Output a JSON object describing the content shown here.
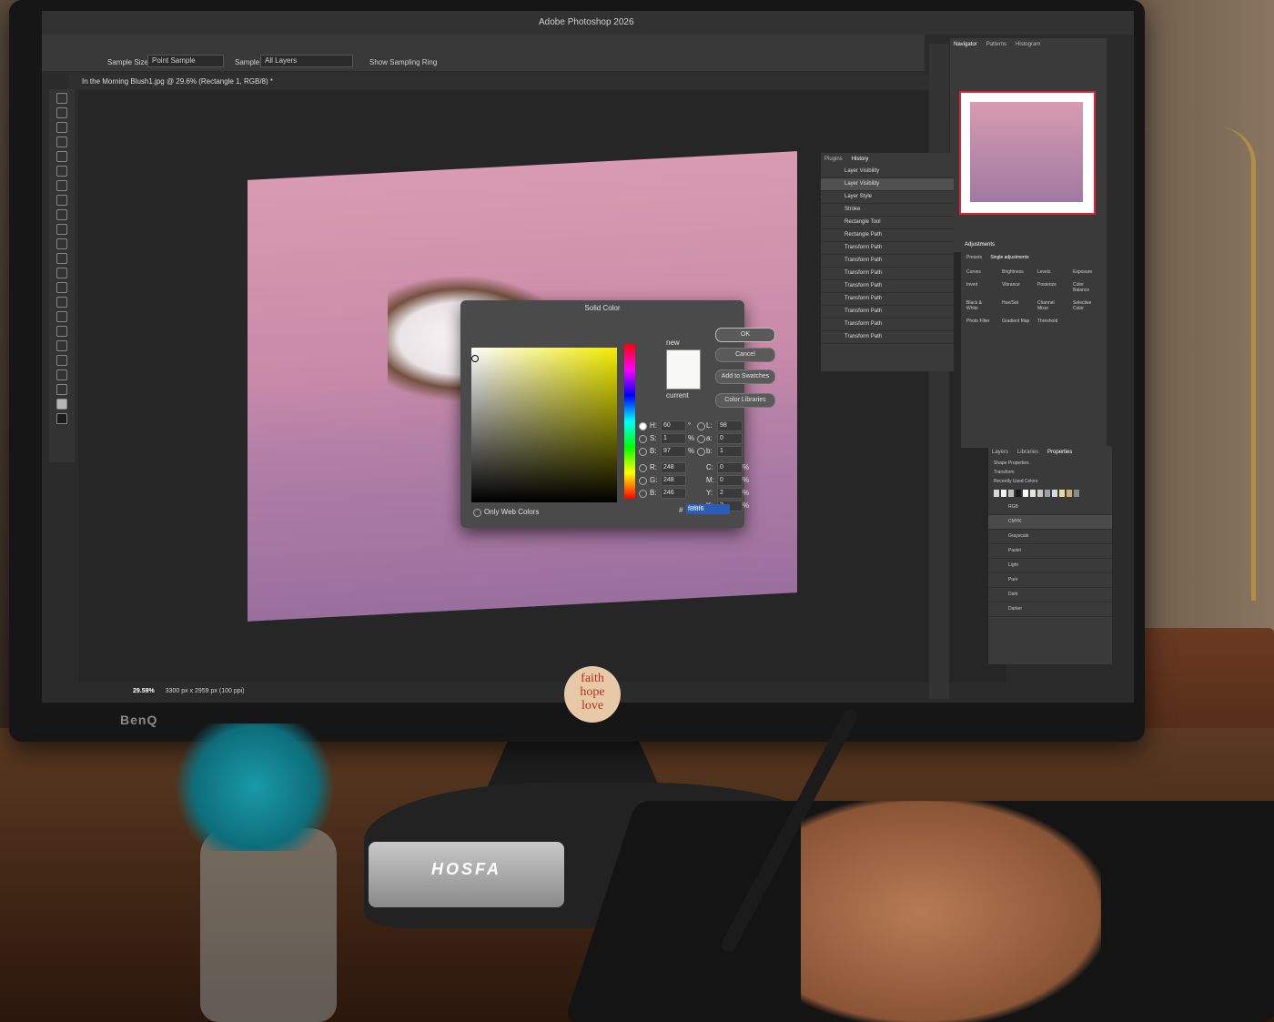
{
  "app": {
    "title": "Adobe Photoshop 2026",
    "monitor_brand": "BenQ",
    "sticker": [
      "faith",
      "hope",
      "love"
    ],
    "device_label": "HOSFA"
  },
  "options_bar": {
    "sample_size_label": "Sample Size:",
    "sample_size_value": "Point Sample",
    "sample_label": "Sample:",
    "sample_value": "All Layers",
    "sampling_ring_label": "Show Sampling Ring"
  },
  "document": {
    "tab_title": "In the Morning Blush1.jpg @ 29.6% (Rectangle 1, RGB/8) *",
    "zoom": "29.59%",
    "dimensions": "3300 px x 2959 px (100 ppi)"
  },
  "color_dialog": {
    "title": "Solid Color",
    "new_label": "new",
    "current_label": "current",
    "ok": "OK",
    "cancel": "Cancel",
    "add_to_swatches": "Add to Swatches",
    "color_libraries": "Color Libraries",
    "only_web_colors": "Only Web Colors",
    "hsb": [
      {
        "label": "H:",
        "value": "60",
        "unit": "°"
      },
      {
        "label": "S:",
        "value": "1",
        "unit": "%"
      },
      {
        "label": "B:",
        "value": "97",
        "unit": "%"
      }
    ],
    "rgb": [
      {
        "label": "R:",
        "value": "248"
      },
      {
        "label": "G:",
        "value": "248"
      },
      {
        "label": "B:",
        "value": "246"
      }
    ],
    "lab": [
      {
        "label": "L:",
        "value": "98"
      },
      {
        "label": "a:",
        "value": "0"
      },
      {
        "label": "b:",
        "value": "1"
      }
    ],
    "cmyk": [
      {
        "label": "C:",
        "value": "0",
        "unit": "%"
      },
      {
        "label": "M:",
        "value": "0",
        "unit": "%"
      },
      {
        "label": "Y:",
        "value": "2",
        "unit": "%"
      },
      {
        "label": "K:",
        "value": "3",
        "unit": "%"
      }
    ],
    "hex_label": "#",
    "hex": "f8f8f6",
    "new_color": "#f8f8f6"
  },
  "navigator_panel": {
    "tabs": [
      "Navigator",
      "Patterns",
      "Histogram"
    ]
  },
  "history_panel": {
    "tabs": [
      "Plugins",
      "History"
    ],
    "items": [
      "Layer Visibility",
      "Layer Visibility",
      "Layer Style",
      "Stroke",
      "Rectangle Tool",
      "Rectangle Path",
      "Transform Path",
      "Transform Path",
      "Transform Path",
      "Transform Path",
      "Transform Path",
      "Transform Path",
      "Transform Path",
      "Transform Path"
    ]
  },
  "adjustments_panel": {
    "tabs": [
      "Adjustments"
    ],
    "presets_label": "Presets",
    "single_label": "Single adjustments",
    "items": [
      "Curves",
      "Brightness",
      "Levels",
      "Exposure",
      "Invert",
      "Vibrance",
      "Posterize",
      "Color Balance",
      "Black & White",
      "Hue/Sat",
      "Channel Mixer",
      "Selective Color",
      "Photo Filter",
      "Gradient Map",
      "Threshold"
    ]
  },
  "properties_panel": {
    "tabs": [
      "Layers",
      "Libraries",
      "Properties"
    ],
    "shape_label": "Shape Properties",
    "transform_label": "Transform",
    "recent_colors_label": "Recently Used Colors",
    "swatch_groups": [
      "RGB",
      "CMYK",
      "Grayscale",
      "Pastel",
      "Light",
      "Pure",
      "Dark",
      "Darker"
    ],
    "recent_colors": [
      "#d8d8d8",
      "#f2f2f2",
      "#bfbfbf",
      "#1a1a1a",
      "#ffffff",
      "#e8e6d8",
      "#c9c9c9",
      "#a0a0a0",
      "#dcdcdc",
      "#e8d9a8",
      "#c8b070",
      "#8a8a8a"
    ]
  }
}
